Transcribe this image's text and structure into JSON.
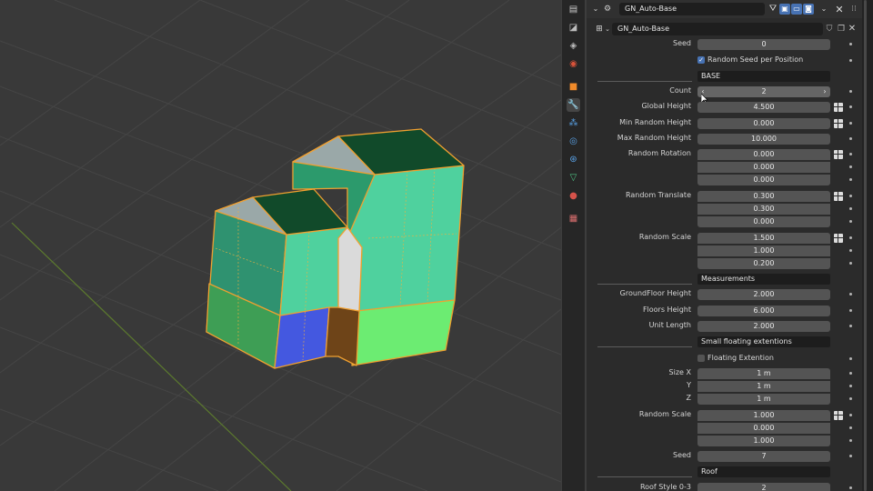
{
  "editor_header": {
    "object_name": "GN_Auto-Base"
  },
  "modifier": {
    "name": "GN_Auto-Base"
  },
  "rows": {
    "seed": {
      "label": "Seed",
      "value": "0"
    },
    "random_seed": {
      "label": "Random Seed per Position",
      "checked": true
    },
    "base_header": {
      "label": "BASE"
    },
    "count": {
      "label": "Count",
      "value": "2",
      "left_arrow": "‹",
      "right_arrow": "›"
    },
    "global_height": {
      "label": "Global Height",
      "value": "4.500"
    },
    "min_random_height": {
      "label": "Min Random Height",
      "value": "0.000"
    },
    "max_random_height": {
      "label": "Max Random Height",
      "value": "10.000"
    },
    "random_rotation": {
      "label": "Random Rotation",
      "values": [
        "0.000",
        "0.000",
        "0.000"
      ]
    },
    "random_translate": {
      "label": "Random Translate",
      "values": [
        "0.300",
        "0.300",
        "0.000"
      ]
    },
    "random_scale": {
      "label": "Random Scale",
      "values": [
        "1.500",
        "1.000",
        "0.200"
      ]
    },
    "measurements_header": {
      "label": "Measurements"
    },
    "groundfloor_height": {
      "label": "GroundFloor Height",
      "value": "2.000"
    },
    "floors_height": {
      "label": "Floors Height",
      "value": "6.000"
    },
    "unit_length": {
      "label": "Unit Length",
      "value": "2.000"
    },
    "small_floating_header": {
      "label": "Small floating extentions"
    },
    "floating_extention": {
      "label": "Floating Extention",
      "checked": false
    },
    "size": {
      "label_x": "Size X",
      "label_y": "Y",
      "label_z": "Z",
      "values": [
        "1 m",
        "1 m",
        "1 m"
      ]
    },
    "random_scale_2": {
      "label": "Random Scale",
      "values": [
        "1.000",
        "0.000",
        "1.000"
      ]
    },
    "seed_2": {
      "label": "Seed",
      "value": "7"
    },
    "roof_header": {
      "label": "Roof"
    },
    "roof_style": {
      "label": "Roof Style 0-3",
      "value": "2"
    }
  },
  "tabs": [
    "tool",
    "render",
    "output",
    "view-layer",
    "scene",
    "world",
    "object",
    "modifiers",
    "particles",
    "physics",
    "constraints",
    "data",
    "material",
    "texture"
  ],
  "colors": {
    "accent_blue": "#4772b3",
    "selection_orange": "#f0a030",
    "field_bg": "#545454",
    "panel_bg": "#2b2b2b",
    "viewport_bg": "#393939"
  }
}
